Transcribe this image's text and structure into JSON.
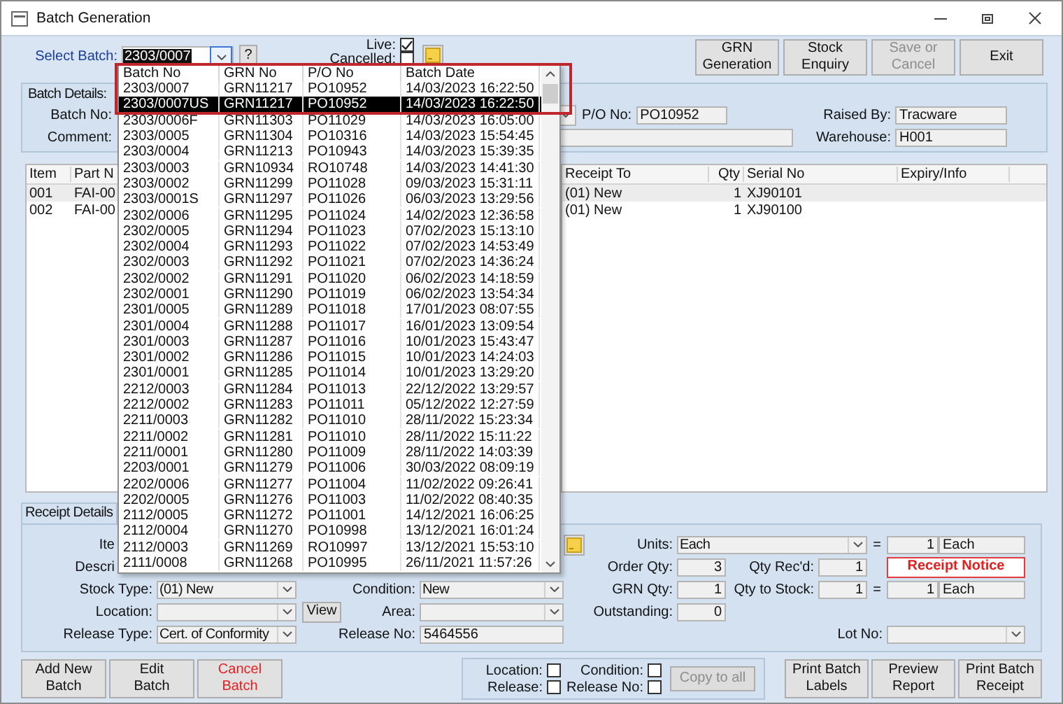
{
  "window": {
    "title": "Batch Generation"
  },
  "select_batch": {
    "label": "Select Batch:",
    "value": "2303/0007",
    "help": "?"
  },
  "flags": [
    {
      "label": "Live:",
      "checked": true
    },
    {
      "label": "Cancelled:",
      "checked": false
    }
  ],
  "actions": [
    {
      "label": "GRN\nGeneration",
      "disabled": false
    },
    {
      "label": "Stock\nEnquiry",
      "disabled": false
    },
    {
      "label": "Save or\nCancel",
      "disabled": true
    },
    {
      "label": "Exit",
      "disabled": false
    }
  ],
  "batch_details": {
    "caption": "Batch Details:",
    "batch_no_label": "Batch No:",
    "comment_label": "Comment:",
    "po_no_label": "P/O No:",
    "po_no": "PO10952",
    "raised_by_label": "Raised By:",
    "raised_by": "Tracware",
    "warehouse_label": "Warehouse:",
    "warehouse": "H001"
  },
  "items_table": {
    "columns": [
      "Item",
      "Part N"
    ],
    "rows": [
      {
        "item": "001",
        "part_no": "FAI-00",
        "selected": true
      },
      {
        "item": "002",
        "part_no": "FAI-00",
        "selected": false
      }
    ]
  },
  "receipt_table": {
    "columns": [
      "Receipt To",
      "Qty",
      "Serial No",
      "Expiry/Info"
    ],
    "rows": [
      {
        "receipt_to": "(01) New",
        "qty": "1",
        "serial_no": "XJ90101",
        "selected": true
      },
      {
        "receipt_to": "(01) New",
        "qty": "1",
        "serial_no": "XJ90100",
        "selected": false
      }
    ]
  },
  "tabs": [
    {
      "label": "Receipt Details",
      "selected": true
    }
  ],
  "receipt_details": {
    "item_label": "Ite",
    "description_label": "Descri",
    "units_label": "Units:",
    "units": "Each",
    "units_eq": "=",
    "units_factor": "1",
    "units_base": "Each",
    "order_qty_label": "Order Qty:",
    "order_qty": "3",
    "qty_recd_label": "Qty Rec'd:",
    "qty_recd": "1",
    "notice": "Receipt Notice",
    "stock_type_label": "Stock Type:",
    "stock_type": "(01) New",
    "condition_label": "Condition:",
    "condition": "New",
    "grn_qty_label": "GRN Qty:",
    "grn_qty": "1",
    "qty_to_stock_label": "Qty to Stock:",
    "qty_to_stock": "1",
    "stock_eq": "=",
    "stock_factor": "1",
    "stock_base": "Each",
    "location_label": "Location:",
    "view_button": "View",
    "area_label": "Area:",
    "outstanding_label": "Outstanding:",
    "outstanding": "0",
    "release_type_label": "Release Type:",
    "release_type": "Cert. of Conformity",
    "release_no_label": "Release No:",
    "release_no": "5464556",
    "lot_no_label": "Lot No:"
  },
  "batch_buttons": [
    {
      "label": "Add New\nBatch",
      "kind": "normal"
    },
    {
      "label": "Edit\nBatch",
      "kind": "normal"
    },
    {
      "label": "Cancel\nBatch",
      "kind": "danger"
    }
  ],
  "copy_options": [
    {
      "label": "Location:",
      "checked": false
    },
    {
      "label": "Condition:",
      "checked": false
    },
    {
      "label": "Release:",
      "checked": false
    },
    {
      "label": "Release No:",
      "checked": false
    }
  ],
  "copy_button": {
    "label": "Copy to all",
    "disabled": true
  },
  "print_buttons": [
    {
      "label": "Print Batch\nLabels"
    },
    {
      "label": "Preview\nReport"
    },
    {
      "label": "Print Batch\nReceipt"
    }
  ],
  "batch_dropdown": {
    "columns": [
      "Batch No",
      "GRN No",
      "P/O No",
      "Batch Date"
    ],
    "rows": [
      {
        "batch_no": "2303/0007",
        "grn_no": "GRN11217",
        "po_no": "PO10952",
        "batch_date": "14/03/2023 16:22:50",
        "selected": false
      },
      {
        "batch_no": "2303/0007US",
        "grn_no": "GRN11217",
        "po_no": "PO10952",
        "batch_date": "14/03/2023 16:22:50",
        "selected": true
      },
      {
        "batch_no": "2303/0006F",
        "grn_no": "GRN11303",
        "po_no": "PO11029",
        "batch_date": "14/03/2023 16:05:00",
        "selected": false
      },
      {
        "batch_no": "2303/0005",
        "grn_no": "GRN11304",
        "po_no": "PO10316",
        "batch_date": "14/03/2023 15:54:45",
        "selected": false
      },
      {
        "batch_no": "2303/0004",
        "grn_no": "GRN11213",
        "po_no": "PO10943",
        "batch_date": "14/03/2023 15:39:35",
        "selected": false
      },
      {
        "batch_no": "2303/0003",
        "grn_no": "GRN10934",
        "po_no": "RO10748",
        "batch_date": "14/03/2023 14:41:30",
        "selected": false
      },
      {
        "batch_no": "2303/0002",
        "grn_no": "GRN11299",
        "po_no": "PO11028",
        "batch_date": "09/03/2023 15:31:11",
        "selected": false
      },
      {
        "batch_no": "2303/0001S",
        "grn_no": "GRN11297",
        "po_no": "PO11026",
        "batch_date": "06/03/2023 13:29:56",
        "selected": false
      },
      {
        "batch_no": "2302/0006",
        "grn_no": "GRN11295",
        "po_no": "PO11024",
        "batch_date": "14/02/2023 12:36:58",
        "selected": false
      },
      {
        "batch_no": "2302/0005",
        "grn_no": "GRN11294",
        "po_no": "PO11023",
        "batch_date": "07/02/2023 15:13:10",
        "selected": false
      },
      {
        "batch_no": "2302/0004",
        "grn_no": "GRN11293",
        "po_no": "PO11022",
        "batch_date": "07/02/2023 14:53:49",
        "selected": false
      },
      {
        "batch_no": "2302/0003",
        "grn_no": "GRN11292",
        "po_no": "PO11021",
        "batch_date": "07/02/2023 14:36:24",
        "selected": false
      },
      {
        "batch_no": "2302/0002",
        "grn_no": "GRN11291",
        "po_no": "PO11020",
        "batch_date": "06/02/2023 14:18:59",
        "selected": false
      },
      {
        "batch_no": "2302/0001",
        "grn_no": "GRN11290",
        "po_no": "PO11019",
        "batch_date": "06/02/2023 13:54:34",
        "selected": false
      },
      {
        "batch_no": "2301/0005",
        "grn_no": "GRN11289",
        "po_no": "PO11018",
        "batch_date": "17/01/2023 08:07:55",
        "selected": false
      },
      {
        "batch_no": "2301/0004",
        "grn_no": "GRN11288",
        "po_no": "PO11017",
        "batch_date": "16/01/2023 13:09:54",
        "selected": false
      },
      {
        "batch_no": "2301/0003",
        "grn_no": "GRN11287",
        "po_no": "PO11016",
        "batch_date": "10/01/2023 15:43:47",
        "selected": false
      },
      {
        "batch_no": "2301/0002",
        "grn_no": "GRN11286",
        "po_no": "PO11015",
        "batch_date": "10/01/2023 14:24:03",
        "selected": false
      },
      {
        "batch_no": "2301/0001",
        "grn_no": "GRN11285",
        "po_no": "PO11014",
        "batch_date": "10/01/2023 13:29:20",
        "selected": false
      },
      {
        "batch_no": "2212/0003",
        "grn_no": "GRN11284",
        "po_no": "PO11013",
        "batch_date": "22/12/2022 13:29:57",
        "selected": false
      },
      {
        "batch_no": "2212/0002",
        "grn_no": "GRN11283",
        "po_no": "PO11011",
        "batch_date": "05/12/2022 12:27:59",
        "selected": false
      },
      {
        "batch_no": "2211/0003",
        "grn_no": "GRN11282",
        "po_no": "PO11010",
        "batch_date": "28/11/2022 15:23:34",
        "selected": false
      },
      {
        "batch_no": "2211/0002",
        "grn_no": "GRN11281",
        "po_no": "PO11010",
        "batch_date": "28/11/2022 15:11:22",
        "selected": false
      },
      {
        "batch_no": "2211/0001",
        "grn_no": "GRN11280",
        "po_no": "PO11009",
        "batch_date": "28/11/2022 14:03:39",
        "selected": false
      },
      {
        "batch_no": "2203/0001",
        "grn_no": "GRN11279",
        "po_no": "PO11006",
        "batch_date": "30/03/2022 08:09:19",
        "selected": false
      },
      {
        "batch_no": "2202/0006",
        "grn_no": "GRN11277",
        "po_no": "PO11004",
        "batch_date": "11/02/2022 09:26:41",
        "selected": false
      },
      {
        "batch_no": "2202/0005",
        "grn_no": "GRN11276",
        "po_no": "PO11003",
        "batch_date": "11/02/2022 08:40:35",
        "selected": false
      },
      {
        "batch_no": "2112/0005",
        "grn_no": "GRN11272",
        "po_no": "PO11001",
        "batch_date": "14/12/2021 16:06:25",
        "selected": false
      },
      {
        "batch_no": "2112/0004",
        "grn_no": "GRN11270",
        "po_no": "PO10998",
        "batch_date": "13/12/2021 16:01:24",
        "selected": false
      },
      {
        "batch_no": "2112/0003",
        "grn_no": "GRN11269",
        "po_no": "RO10997",
        "batch_date": "13/12/2021 15:53:10",
        "selected": false
      },
      {
        "batch_no": "2111/0008",
        "grn_no": "GRN11268",
        "po_no": "PO10995",
        "batch_date": "26/11/2021 11:57:26",
        "selected": false
      }
    ]
  }
}
